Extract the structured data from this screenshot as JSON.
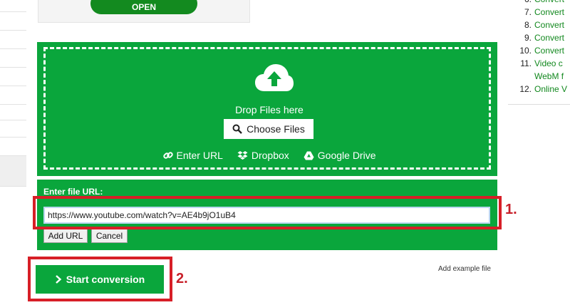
{
  "ad": {
    "open_label": "OPEN"
  },
  "upload": {
    "drop_text": "Drop Files here",
    "choose_label": "Choose Files",
    "sources": [
      {
        "label": "Enter URL",
        "icon": "link-icon"
      },
      {
        "label": "Dropbox",
        "icon": "dropbox-icon"
      },
      {
        "label": "Google Drive",
        "icon": "google-drive-icon"
      }
    ]
  },
  "url_panel": {
    "label": "Enter file URL:",
    "value": "https://www.youtube.com/watch?v=AE4b9jO1uB4",
    "add_label": "Add URL",
    "cancel_label": "Cancel"
  },
  "annotations": {
    "step1": "1.",
    "step2": "2."
  },
  "actions": {
    "start_label": "Start conversion",
    "example_label": "Add example file"
  },
  "right_list": [
    {
      "num": "6.",
      "text": "Convert"
    },
    {
      "num": "7.",
      "text": "Convert"
    },
    {
      "num": "8.",
      "text": "Convert"
    },
    {
      "num": "9.",
      "text": "Convert"
    },
    {
      "num": "10.",
      "text": "Convert"
    },
    {
      "num": "11.",
      "text": "Video c",
      "cont": "WebM f"
    },
    {
      "num": "12.",
      "text": "Online V"
    }
  ],
  "colors": {
    "green": "#0aa63c",
    "red": "#d71f27",
    "link_green": "#12881e"
  }
}
